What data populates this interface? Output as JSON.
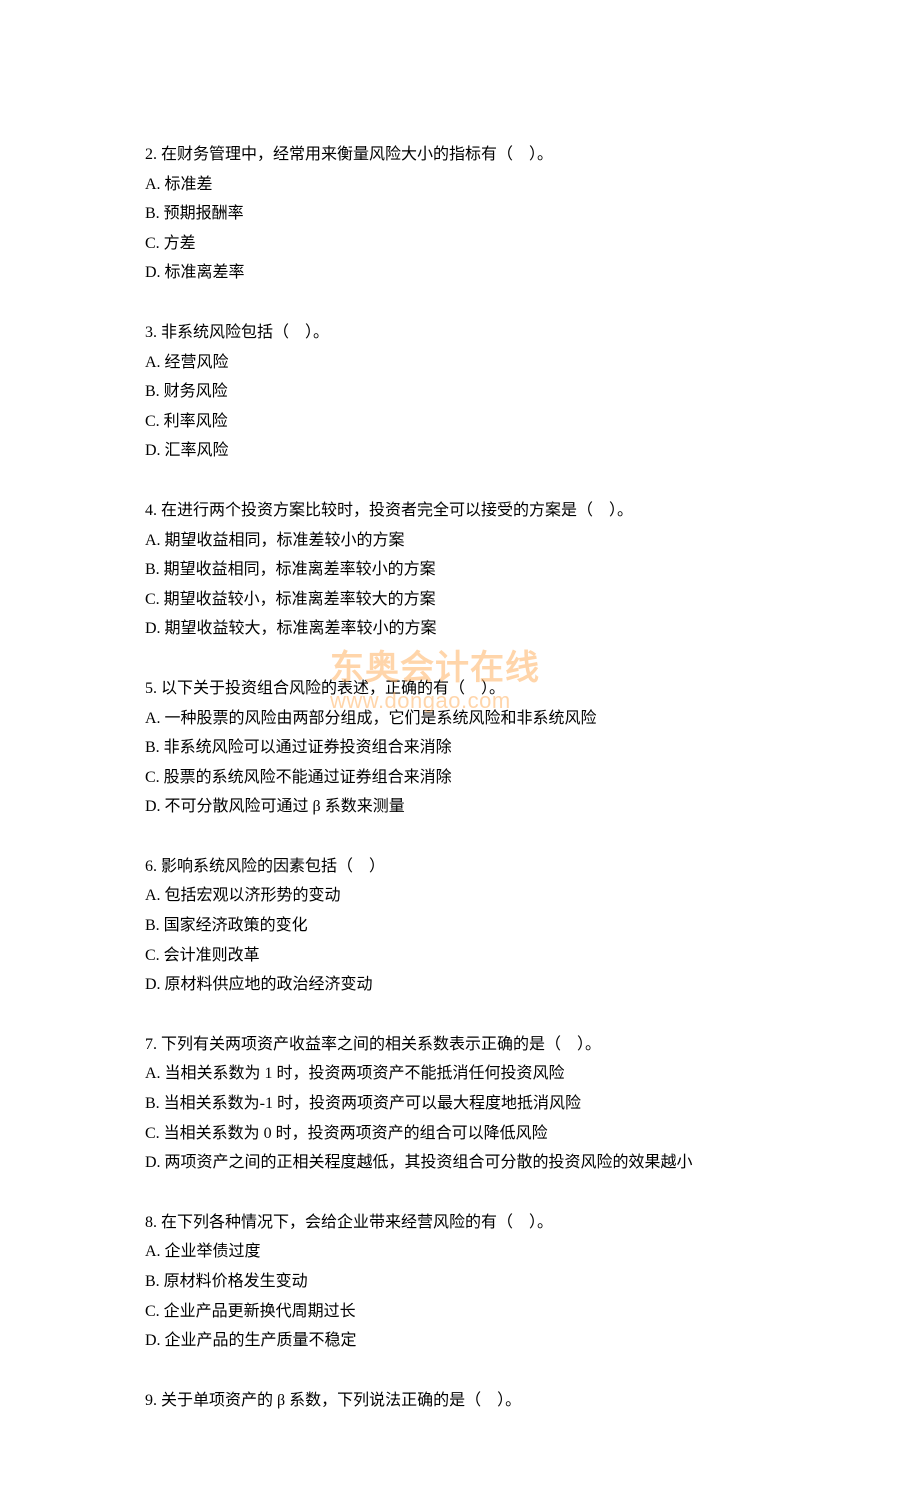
{
  "watermark": {
    "cn": "东奥会计在线",
    "en": "www.dongao.com"
  },
  "questions": [
    {
      "stem": "2. 在财务管理中，经常用来衡量风险大小的指标有（　）。",
      "options": [
        "A. 标准差",
        "B. 预期报酬率",
        "C. 方差",
        "D. 标准离差率"
      ]
    },
    {
      "stem": "3. 非系统风险包括（　）。",
      "options": [
        "A. 经营风险",
        "B. 财务风险",
        "C. 利率风险",
        "D. 汇率风险"
      ]
    },
    {
      "stem": "4. 在进行两个投资方案比较时，投资者完全可以接受的方案是（　）。",
      "options": [
        "A. 期望收益相同，标准差较小的方案",
        "B. 期望收益相同，标准离差率较小的方案",
        "C. 期望收益较小，标准离差率较大的方案",
        "D. 期望收益较大，标准离差率较小的方案"
      ]
    },
    {
      "stem": "5. 以下关于投资组合风险的表述，正确的有（　）。",
      "options": [
        "A. 一种股票的风险由两部分组成，它们是系统风险和非系统风险",
        "B. 非系统风险可以通过证券投资组合来消除",
        "C. 股票的系统风险不能通过证券组合来消除",
        "D. 不可分散风险可通过 β 系数来测量"
      ]
    },
    {
      "stem": "6. 影响系统风险的因素包括（　）",
      "options": [
        "A. 包括宏观以济形势的变动",
        "B. 国家经济政策的变化",
        "C. 会计准则改革",
        "D. 原材料供应地的政治经济变动"
      ]
    },
    {
      "stem": "7. 下列有关两项资产收益率之间的相关系数表示正确的是（　）。",
      "options": [
        "A. 当相关系数为 1 时，投资两项资产不能抵消任何投资风险",
        "B. 当相关系数为-1 时，投资两项资产可以最大程度地抵消风险",
        "C. 当相关系数为 0 时，投资两项资产的组合可以降低风险",
        "D. 两项资产之间的正相关程度越低，其投资组合可分散的投资风险的效果越小"
      ]
    },
    {
      "stem": "8. 在下列各种情况下，会给企业带来经营风险的有（　）。",
      "options": [
        "A. 企业举债过度",
        "B. 原材料价格发生变动",
        "C. 企业产品更新换代周期过长",
        "D. 企业产品的生产质量不稳定"
      ]
    },
    {
      "stem": "9. 关于单项资产的 β 系数，下列说法正确的是（　）。",
      "options": []
    }
  ]
}
